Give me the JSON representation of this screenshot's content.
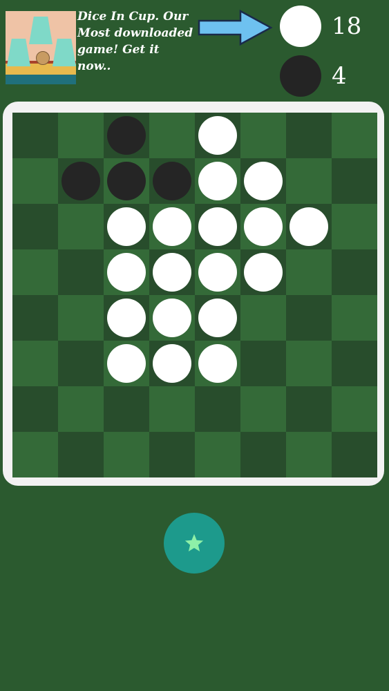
{
  "ad": {
    "text": "Dice In Cup. Our Most downloaded game! Get it now..",
    "thumbnail_icon": "dice-in-cup-thumbnail"
  },
  "scores": {
    "white": "18",
    "black": "4"
  },
  "colors": {
    "background": "#2b5a2f",
    "board_dark": "#284d2c",
    "board_light": "#346a38",
    "frame": "#f2f2f2",
    "white_disc": "#ffffff",
    "black_disc": "#252525",
    "arrow": "#6ec1f0",
    "star_button": "#1d9a8c",
    "star": "#8ef0a8"
  },
  "board": [
    [
      "",
      "",
      "B",
      "",
      "W",
      "",
      "",
      ""
    ],
    [
      "",
      "B",
      "B",
      "B",
      "W",
      "W",
      "",
      ""
    ],
    [
      "",
      "",
      "W",
      "W",
      "W",
      "W",
      "W",
      ""
    ],
    [
      "",
      "",
      "W",
      "W",
      "W",
      "W",
      "",
      ""
    ],
    [
      "",
      "",
      "W",
      "W",
      "W",
      "",
      "",
      ""
    ],
    [
      "",
      "",
      "W",
      "W",
      "W",
      "",
      "",
      ""
    ],
    [
      "",
      "",
      "",
      "",
      "",
      "",
      "",
      ""
    ],
    [
      "",
      "",
      "",
      "",
      "",
      "",
      "",
      ""
    ]
  ],
  "star_button": {
    "icon": "star-icon"
  }
}
